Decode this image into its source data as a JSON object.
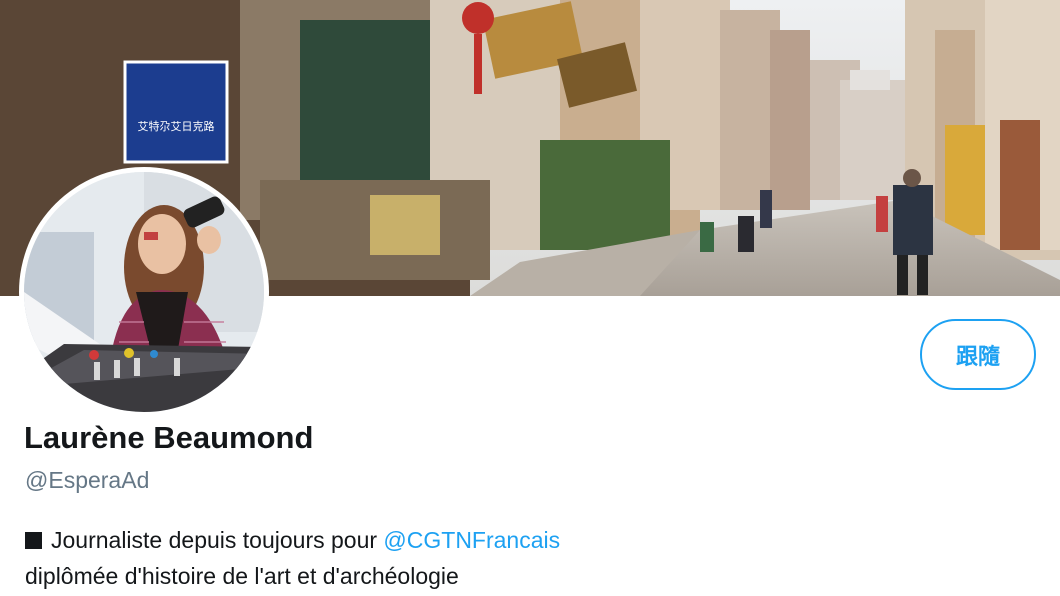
{
  "banner": {
    "sign_text": "艾特尕艾日克路"
  },
  "profile": {
    "display_name": "Laurène Beaumond",
    "handle": "@EsperaAd",
    "follow_label": "跟隨",
    "bio": {
      "bullet_icon": "black-square-icon",
      "line1_text": "Journaliste depuis toujours pour ",
      "line1_mention": "@CGTNFrancais",
      "line2_text": "diplômée d'histoire de l'art et d'archéologie"
    }
  },
  "colors": {
    "accent": "#1da1f2",
    "text": "#14171a",
    "muted": "#657786",
    "background": "#ffffff"
  }
}
